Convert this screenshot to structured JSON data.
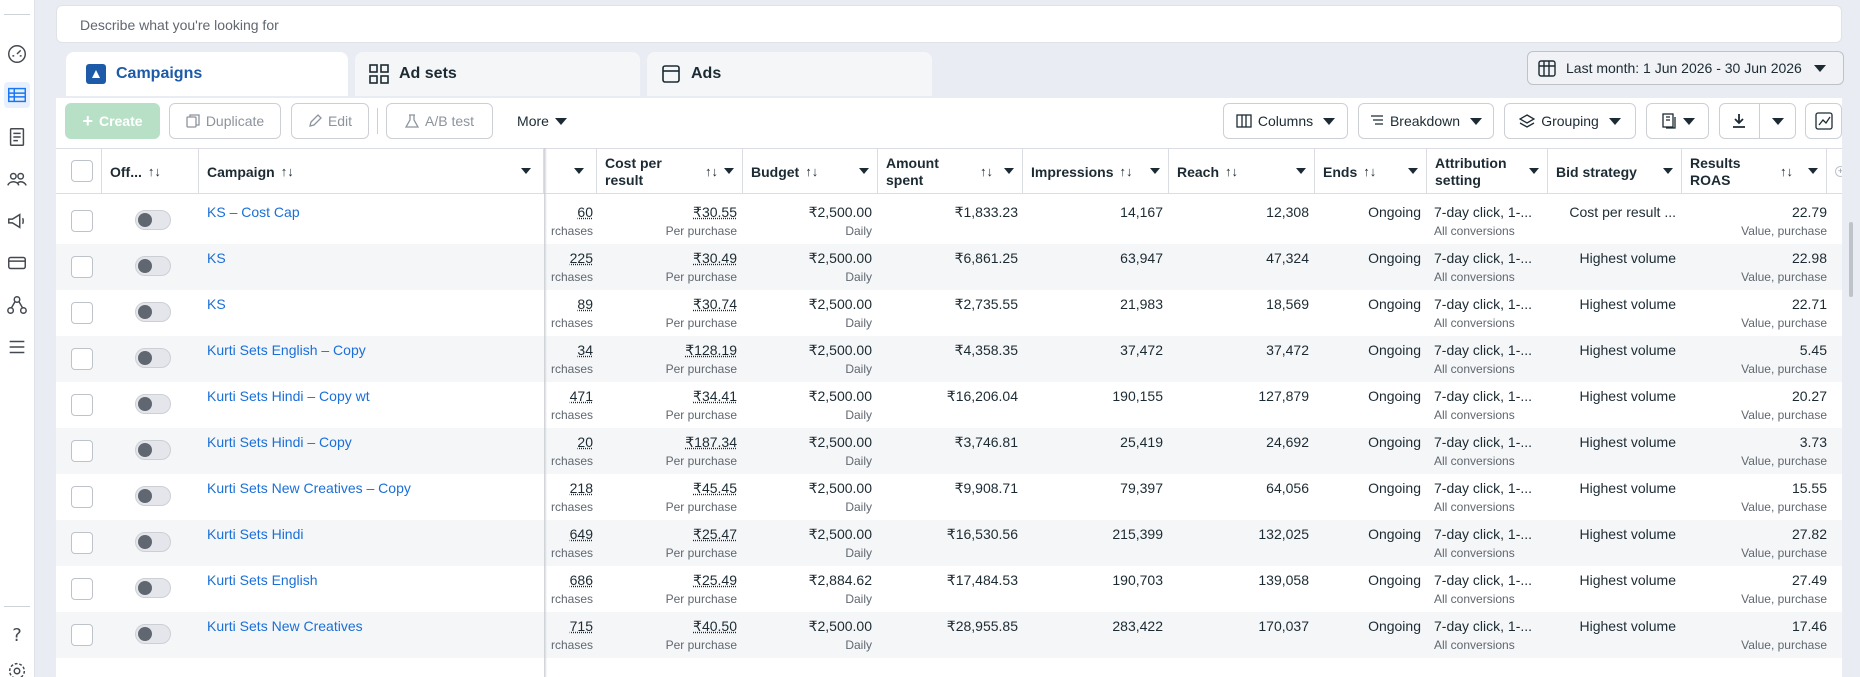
{
  "search": {
    "placeholder": "Describe what you're looking for"
  },
  "tabs": [
    {
      "label": "Campaigns",
      "icon": "campaigns-icon"
    },
    {
      "label": "Ad sets",
      "icon": "adsets-icon"
    },
    {
      "label": "Ads",
      "icon": "ads-icon"
    }
  ],
  "date_range": "Last month: 1 Jun 2026 - 30 Jun 2026",
  "toolbar": {
    "create": "Create",
    "duplicate": "Duplicate",
    "edit": "Edit",
    "ab_test": "A/B test",
    "more": "More",
    "columns": "Columns",
    "breakdown": "Breakdown",
    "grouping": "Grouping"
  },
  "headers": {
    "off": "Off...",
    "campaign": "Campaign",
    "cost_per_result": "Cost per result",
    "budget": "Budget",
    "amount_spent": "Amount spent",
    "impressions": "Impressions",
    "reach": "Reach",
    "ends": "Ends",
    "attribution": "Attribution setting",
    "bid_strategy": "Bid strategy",
    "results_roas": "Results ROAS"
  },
  "rows": [
    {
      "name": "KS – Cost Cap",
      "results": "60",
      "results_sub": "rchases",
      "cpr": "₹30.55",
      "cpr_sub": "Per purchase",
      "budget": "₹2,500.00",
      "budget_sub": "Daily",
      "spent": "₹1,833.23",
      "impressions": "14,167",
      "reach": "12,308",
      "ends": "Ongoing",
      "attr": "7-day click, 1-...",
      "attr_sub": "All conversions",
      "bid": "Cost per result ...",
      "roas": "22.79",
      "roas_sub": "Value, purchase"
    },
    {
      "name": "KS",
      "results": "225",
      "results_sub": "rchases",
      "cpr": "₹30.49",
      "cpr_sub": "Per purchase",
      "budget": "₹2,500.00",
      "budget_sub": "Daily",
      "spent": "₹6,861.25",
      "impressions": "63,947",
      "reach": "47,324",
      "ends": "Ongoing",
      "attr": "7-day click, 1-...",
      "attr_sub": "All conversions",
      "bid": "Highest volume",
      "roas": "22.98",
      "roas_sub": "Value, purchase"
    },
    {
      "name": "KS",
      "results": "89",
      "results_sub": "rchases",
      "cpr": "₹30.74",
      "cpr_sub": "Per purchase",
      "budget": "₹2,500.00",
      "budget_sub": "Daily",
      "spent": "₹2,735.55",
      "impressions": "21,983",
      "reach": "18,569",
      "ends": "Ongoing",
      "attr": "7-day click, 1-...",
      "attr_sub": "All conversions",
      "bid": "Highest volume",
      "roas": "22.71",
      "roas_sub": "Value, purchase"
    },
    {
      "name": "Kurti Sets English – Copy",
      "results": "34",
      "results_sub": "rchases",
      "cpr": "₹128.19",
      "cpr_sub": "Per purchase",
      "budget": "₹2,500.00",
      "budget_sub": "Daily",
      "spent": "₹4,358.35",
      "impressions": "37,472",
      "reach": "37,472",
      "ends": "Ongoing",
      "attr": "7-day click, 1-...",
      "attr_sub": "All conversions",
      "bid": "Highest volume",
      "roas": "5.45",
      "roas_sub": "Value, purchase"
    },
    {
      "name": "Kurti Sets Hindi – Copy wt",
      "results": "471",
      "results_sub": "rchases",
      "cpr": "₹34.41",
      "cpr_sub": "Per purchase",
      "budget": "₹2,500.00",
      "budget_sub": "Daily",
      "spent": "₹16,206.04",
      "impressions": "190,155",
      "reach": "127,879",
      "ends": "Ongoing",
      "attr": "7-day click, 1-...",
      "attr_sub": "All conversions",
      "bid": "Highest volume",
      "roas": "20.27",
      "roas_sub": "Value, purchase"
    },
    {
      "name": "Kurti Sets Hindi – Copy",
      "results": "20",
      "results_sub": "rchases",
      "cpr": "₹187.34",
      "cpr_sub": "Per purchase",
      "budget": "₹2,500.00",
      "budget_sub": "Daily",
      "spent": "₹3,746.81",
      "impressions": "25,419",
      "reach": "24,692",
      "ends": "Ongoing",
      "attr": "7-day click, 1-...",
      "attr_sub": "All conversions",
      "bid": "Highest volume",
      "roas": "3.73",
      "roas_sub": "Value, purchase"
    },
    {
      "name": "Kurti Sets New Creatives – Copy",
      "results": "218",
      "results_sub": "rchases",
      "cpr": "₹45.45",
      "cpr_sub": "Per purchase",
      "budget": "₹2,500.00",
      "budget_sub": "Daily",
      "spent": "₹9,908.71",
      "impressions": "79,397",
      "reach": "64,056",
      "ends": "Ongoing",
      "attr": "7-day click, 1-...",
      "attr_sub": "All conversions",
      "bid": "Highest volume",
      "roas": "15.55",
      "roas_sub": "Value, purchase"
    },
    {
      "name": "Kurti Sets Hindi",
      "results": "649",
      "results_sub": "rchases",
      "cpr": "₹25.47",
      "cpr_sub": "Per purchase",
      "budget": "₹2,500.00",
      "budget_sub": "Daily",
      "spent": "₹16,530.56",
      "impressions": "215,399",
      "reach": "132,025",
      "ends": "Ongoing",
      "attr": "7-day click, 1-...",
      "attr_sub": "All conversions",
      "bid": "Highest volume",
      "roas": "27.82",
      "roas_sub": "Value, purchase"
    },
    {
      "name": "Kurti Sets English",
      "results": "686",
      "results_sub": "rchases",
      "cpr": "₹25.49",
      "cpr_sub": "Per purchase",
      "budget": "₹2,884.62",
      "budget_sub": "Daily",
      "spent": "₹17,484.53",
      "impressions": "190,703",
      "reach": "139,058",
      "ends": "Ongoing",
      "attr": "7-day click, 1-...",
      "attr_sub": "All conversions",
      "bid": "Highest volume",
      "roas": "27.49",
      "roas_sub": "Value, purchase"
    },
    {
      "name": "Kurti Sets New Creatives",
      "results": "715",
      "results_sub": "rchases",
      "cpr": "₹40.50",
      "cpr_sub": "Per purchase",
      "budget": "₹2,500.00",
      "budget_sub": "Daily",
      "spent": "₹28,955.85",
      "impressions": "283,422",
      "reach": "170,037",
      "ends": "Ongoing",
      "attr": "7-day click, 1-...",
      "attr_sub": "All conversions",
      "bid": "Highest volume",
      "roas": "17.46",
      "roas_sub": "Value, purchase"
    }
  ],
  "sidebar_icons": [
    "dashboard-icon",
    "campaigns-table-icon",
    "pages-icon",
    "audiences-icon",
    "ads-megaphone-icon",
    "billing-card-icon",
    "network-icon",
    "menu-icon",
    "help-icon",
    "settings-icon"
  ]
}
